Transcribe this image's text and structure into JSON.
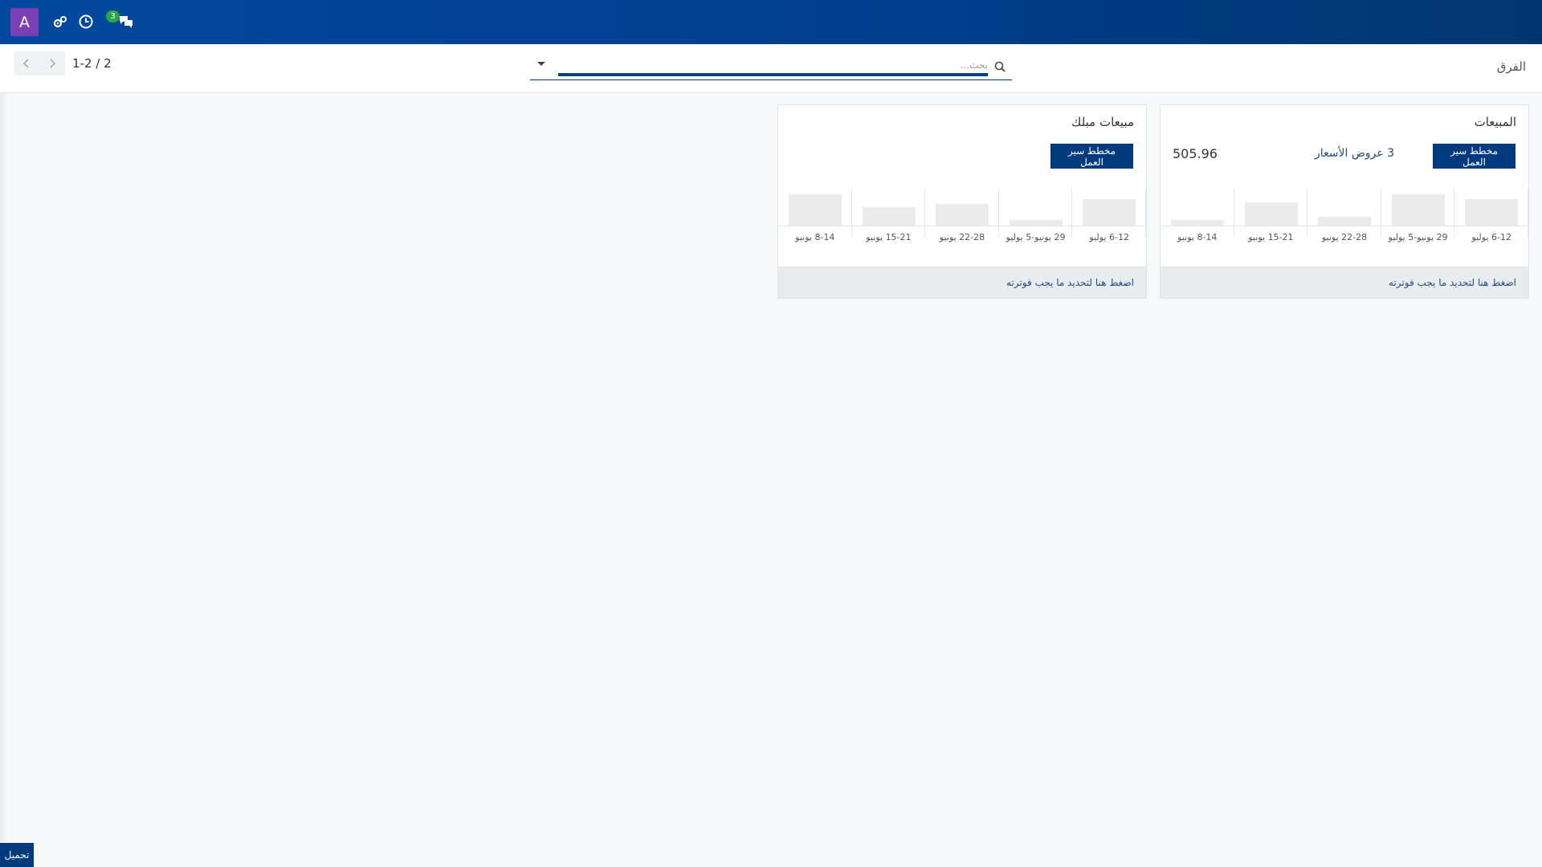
{
  "navbar": {
    "avatar_letter": "A",
    "icons": [
      "settings-gears-icon",
      "clock-icon",
      "chat-icon"
    ],
    "messages_badge": "3"
  },
  "control": {
    "page_title": "الفرق",
    "pager_value": "1-2 / 2",
    "search_placeholder": "بحث..."
  },
  "cards": [
    {
      "title": "المبيعات",
      "pipeline_label": "مخطط سير العمل",
      "quotes_label": "3 عروض الأسعار",
      "amount": "505.96",
      "footer_link": "اضغط هنا لتحديد ما يجب فوترته",
      "chart_data": {
        "type": "bar",
        "categories": [
          "8-14 يونيو",
          "15-21 يونيو",
          "22-28 يونيو",
          "29 يونيو-5 يوليو",
          "6-12 يوليو"
        ],
        "values": [
          0.2,
          0.75,
          0.3,
          1.0,
          0.85
        ],
        "title": "",
        "xlabel": "",
        "ylabel": ""
      }
    },
    {
      "title": "مبيعات مبلك",
      "pipeline_label": "مخطط سير العمل",
      "quotes_label": "",
      "amount": "",
      "footer_link": "اضغط هنا لتحديد ما يجب فوترته",
      "chart_data": {
        "type": "bar",
        "categories": [
          "8-14 يونيو",
          "15-21 يونيو",
          "22-28 يونيو",
          "29 يونيو-5 يوليو",
          "6-12 يوليو"
        ],
        "values": [
          1.0,
          0.6,
          0.7,
          0.2,
          0.85
        ],
        "title": "",
        "xlabel": "",
        "ylabel": ""
      }
    }
  ],
  "footer": {
    "download_label": "تحميل"
  },
  "colors": {
    "navbar": "#00489f",
    "primary": "#003a7e",
    "avatar": "#7b3fb6",
    "badge": "#28a745"
  }
}
